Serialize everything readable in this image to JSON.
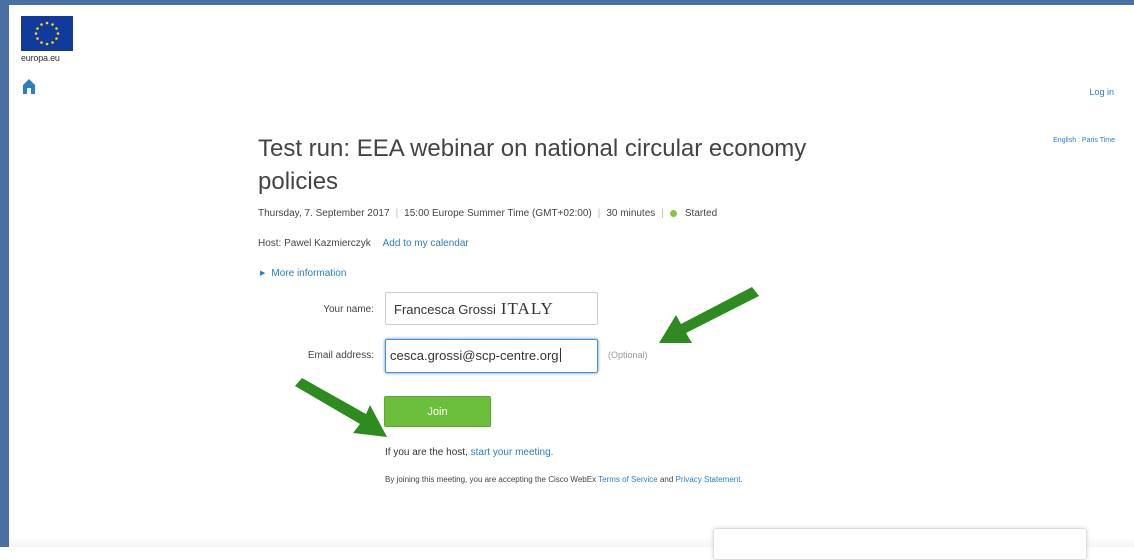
{
  "site": {
    "logo_text": "europa.eu",
    "home_icon": "home-icon"
  },
  "header": {
    "login_label": "Log in",
    "language_timezone": "English : Paris Time"
  },
  "meeting": {
    "title": "Test run: EEA webinar on national circular economy policies",
    "date": "Thursday, 7. September 2017",
    "time": "15:00 Europe Summer Time (GMT+02:00)",
    "duration": "30 minutes",
    "status": "Started",
    "status_color": "#8cc63f",
    "host_label": "Host: Pawel Kazmierczyk",
    "add_to_calendar": "Add to my calendar",
    "more_info": "More information"
  },
  "form": {
    "name_label": "Your name:",
    "name_value": "Francesca Grossi",
    "name_annotation": "ITALY",
    "email_label": "Email address:",
    "email_value": "cesca.grossi@scp-centre.org",
    "email_optional": "(Optional)",
    "join_label": "Join",
    "join_color": "#6cbf3d"
  },
  "footer": {
    "host_prefix": "If you are the host, ",
    "host_link": "start your meeting.",
    "terms_prefix": "By joining this meeting, you are accepting the Cisco WebEx ",
    "terms_link": "Terms of Service",
    "terms_and": " and ",
    "privacy_link": "Privacy Statement",
    "terms_suffix": "."
  },
  "annotations": {
    "arrow_color": "#2e8b1f",
    "arrow_icon": "green-arrow-icon"
  }
}
